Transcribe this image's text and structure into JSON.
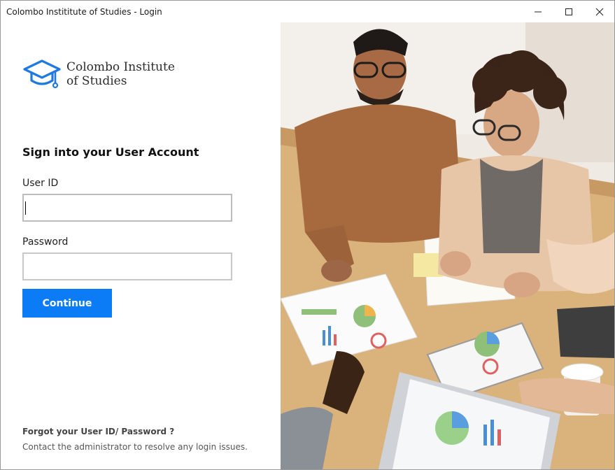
{
  "window": {
    "title": "Colombo Instititute of Studies - Login",
    "controls": {
      "minimize": "minimize-icon",
      "maximize": "maximize-icon",
      "close": "close-icon"
    }
  },
  "brand": {
    "line1": "Colombo Institute",
    "line2": "of Studies",
    "logo_icon": "graduation-cap-icon",
    "logo_color": "#1f7ae0"
  },
  "form": {
    "heading": "Sign into your User Account",
    "user_id_label": "User ID",
    "user_id_value": "",
    "password_label": "Password",
    "password_value": "",
    "continue_label": "Continue",
    "accent_color": "#0b7cf6"
  },
  "help": {
    "forgot_text": "Forgot your User ID/ Password ?",
    "contact_text": "Contact the administrator to resolve any login issues."
  },
  "hero_image": {
    "description_icon": "team-meeting-photo"
  }
}
